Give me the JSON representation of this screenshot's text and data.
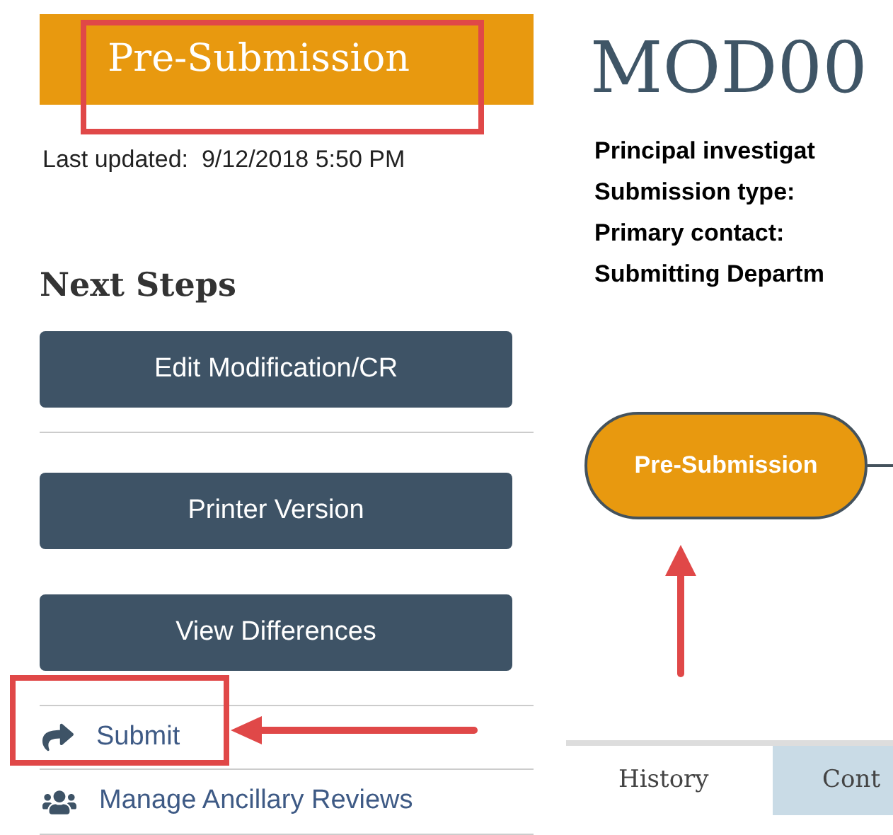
{
  "status_banner": {
    "label": "Pre-Submission"
  },
  "last_updated": "Last updated:  9/12/2018 5:50 PM",
  "next_steps": {
    "heading": "Next Steps",
    "buttons": [
      "Edit Modification/CR",
      "Printer Version",
      "View Differences"
    ],
    "links": [
      {
        "label": "Submit",
        "kind": "share"
      },
      {
        "label": "Manage Ancillary Reviews",
        "kind": "group"
      }
    ]
  },
  "record": {
    "title": "MOD00",
    "fields": [
      "Principal investigat",
      "Submission type:",
      "Primary contact:",
      "Submitting Departm"
    ]
  },
  "workflow": {
    "nodes": [
      {
        "label": "Pre-Submission",
        "selected": true
      }
    ]
  },
  "tabs": [
    {
      "label": "History",
      "selected": true
    },
    {
      "label": "Cont",
      "selected": false
    }
  ]
}
